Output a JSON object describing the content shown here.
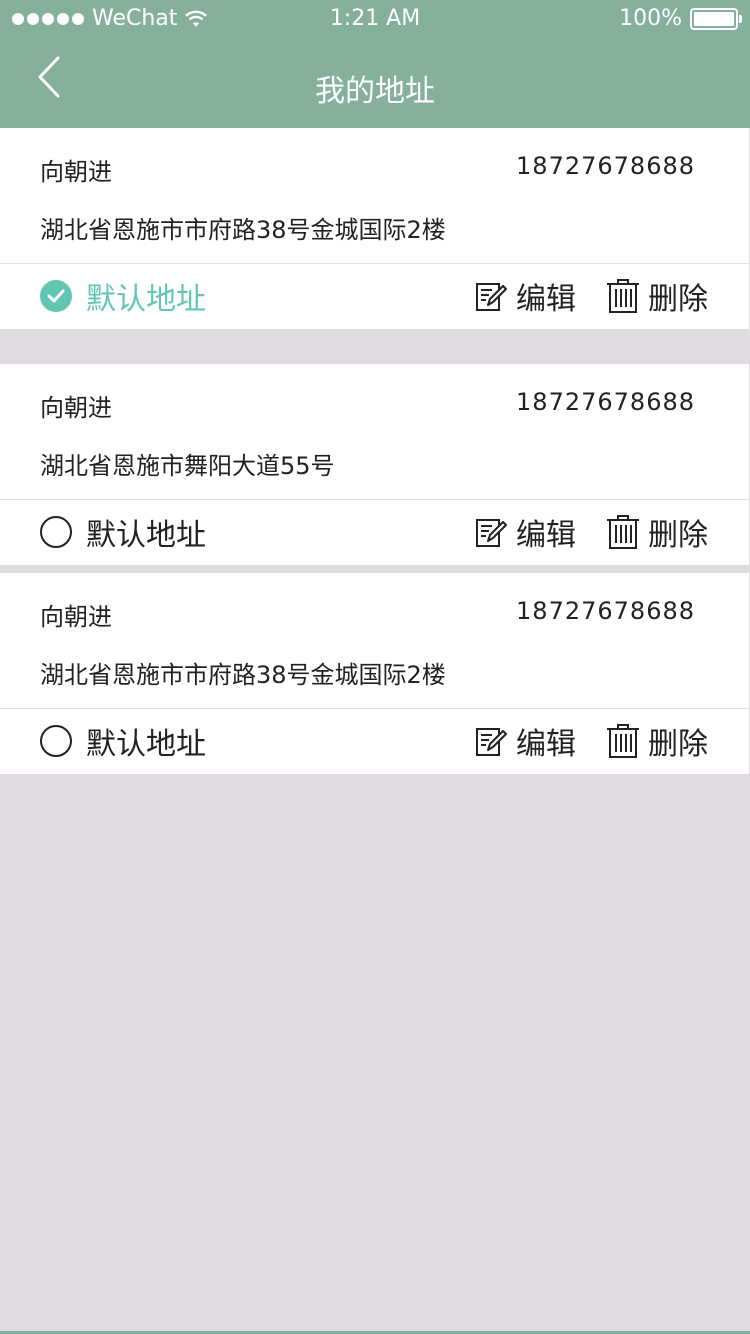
{
  "status_bar": {
    "carrier": "WeChat",
    "time": "1:21 AM",
    "battery": "100%"
  },
  "nav": {
    "title": "我的地址"
  },
  "addresses": [
    {
      "name": "向朝进",
      "phone": "18727678688",
      "address": "湖北省恩施市市府路38号金城国际2楼",
      "default_label": "默认地址",
      "is_default": true,
      "edit_label": "编辑",
      "delete_label": "删除"
    },
    {
      "name": "向朝进",
      "phone": "18727678688",
      "address": "湖北省恩施市舞阳大道55号",
      "default_label": "默认地址",
      "is_default": false,
      "edit_label": "编辑",
      "delete_label": "删除"
    },
    {
      "name": "向朝进",
      "phone": "18727678688",
      "address": "湖北省恩施市市府路38号金城国际2楼",
      "default_label": "默认地址",
      "is_default": false,
      "edit_label": "编辑",
      "delete_label": "删除"
    }
  ],
  "colors": {
    "header": "#85b19b",
    "accent": "#62c6b5",
    "background": "#dfdbe0"
  },
  "icons": [
    "back-icon",
    "check-icon",
    "radio-icon",
    "edit-icon",
    "trash-icon",
    "wifi-icon",
    "battery-icon"
  ]
}
